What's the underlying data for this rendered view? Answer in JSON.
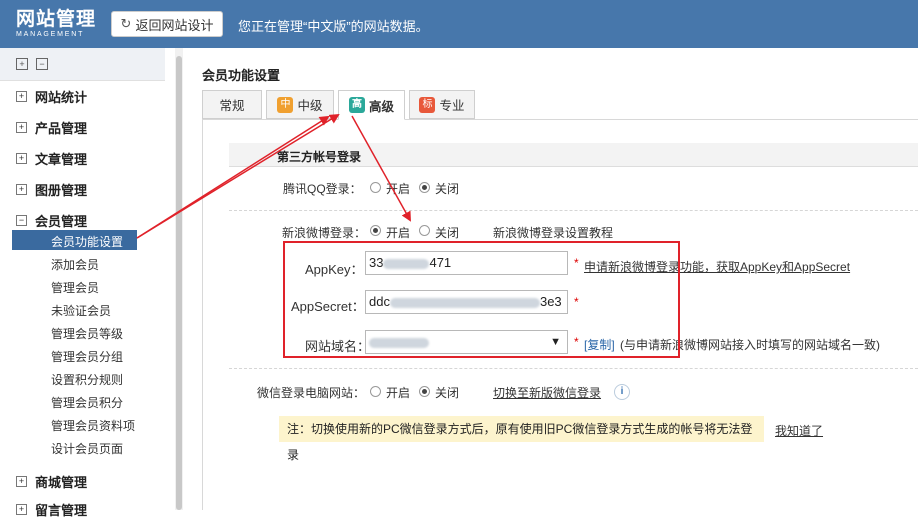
{
  "topbar": {
    "logo_title": "网站管理",
    "logo_sub": "MANAGEMENT",
    "back_label": "返回网站设计",
    "status_text": "您正在管理“中文版”的网站数据。"
  },
  "sidebar": {
    "sections": [
      {
        "label": "网站统计",
        "sign": "+"
      },
      {
        "label": "产品管理",
        "sign": "+"
      },
      {
        "label": "文章管理",
        "sign": "+"
      },
      {
        "label": "图册管理",
        "sign": "+"
      },
      {
        "label": "会员管理",
        "sign": "−"
      },
      {
        "label": "商城管理",
        "sign": "+"
      },
      {
        "label": "留言管理",
        "sign": "+"
      }
    ],
    "member_items": [
      "会员功能设置",
      "添加会员",
      "管理会员",
      "未验证会员",
      "管理会员等级",
      "管理会员分组",
      "设置积分规则",
      "管理会员积分",
      "管理会员资料项",
      "设计会员页面"
    ]
  },
  "main": {
    "page_title": "会员功能设置",
    "tabs": [
      {
        "label": "常规",
        "badge": ""
      },
      {
        "label": "中级",
        "badge": "中"
      },
      {
        "label": "高级",
        "badge": "高"
      },
      {
        "label": "专业",
        "badge": "标"
      }
    ],
    "section_title": "第三方帐号登录",
    "qq": {
      "label": "腾讯QQ登录：",
      "opt_on": "开启",
      "opt_off": "关闭"
    },
    "weibo": {
      "label": "新浪微博登录：",
      "opt_on": "开启",
      "opt_off": "关闭",
      "tutorial": "新浪微博登录设置教程",
      "appkey_label": "AppKey：",
      "appkey_prefix": "33",
      "appkey_suffix": "471",
      "appkey_hint": "申请新浪微博登录功能，获取AppKey和AppSecret",
      "appsecret_label": "AppSecret：",
      "appsecret_prefix": "ddc",
      "appsecret_suffix": "3e3",
      "domain_label": "网站域名：",
      "copy": "[复制]",
      "domain_hint": "(与申请新浪微博网站接入时填写的网站域名一致)"
    },
    "wechat": {
      "label": "微信登录电脑网站：",
      "opt_on": "开启",
      "opt_off": "关闭",
      "switch_link": "切换至新版微信登录",
      "info": "i"
    },
    "notice": {
      "text": "注：切换使用新的PC微信登录方式后，原有使用旧PC微信登录方式生成的帐号将无法登录",
      "ack": "我知道了"
    },
    "required_mark": "*"
  },
  "colors": {
    "topbar": "#4777ab",
    "active_item": "#3a6a9f",
    "annotation": "#e0222a",
    "notice_bg": "#fdf4cd"
  }
}
